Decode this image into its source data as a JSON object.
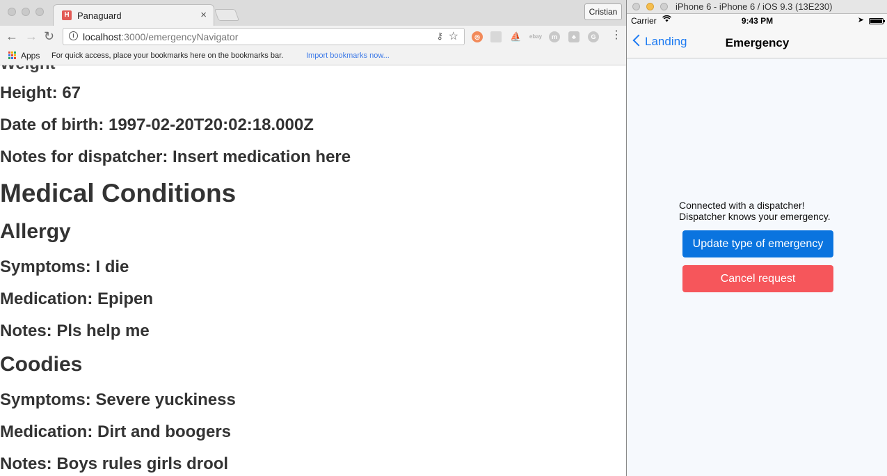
{
  "browser": {
    "tab_title": "Panaguard",
    "tab_favicon_letter": "H",
    "tab_close": "×",
    "profile_name": "Cristian",
    "url_host": "localhost",
    "url_path": ":3000/emergencyNavigator",
    "bookmarks": {
      "apps_label": "Apps",
      "hint": "For quick access, place your bookmarks here on the bookmarks bar.",
      "import_link": "Import bookmarks now..."
    }
  },
  "page": {
    "height": "Height: 67",
    "dob": "Date of birth: 1997-02-20T20:02:18.000Z",
    "notes_dispatcher": "Notes for dispatcher: Insert medication here",
    "conditions_heading": "Medical Conditions",
    "conditions": [
      {
        "name": "Allergy",
        "symptoms": "Symptoms: I die",
        "medication": "Medication: Epipen",
        "notes": "Notes: Pls help me"
      },
      {
        "name": "Coodies",
        "symptoms": "Symptoms: Severe yuckiness",
        "medication": "Medication: Dirt and boogers",
        "notes": "Notes: Boys rules girls drool"
      }
    ]
  },
  "simulator": {
    "window_title": "iPhone 6 - iPhone 6 / iOS 9.3 (13E230)",
    "status": {
      "carrier": "Carrier",
      "time": "9:43 PM"
    },
    "nav": {
      "back_label": "Landing",
      "title": "Emergency"
    },
    "message_line1": "Connected with a dispatcher!",
    "message_line2": "Dispatcher knows your emergency.",
    "update_button": "Update type of emergency",
    "cancel_button": "Cancel request"
  },
  "colors": {
    "ios_blue": "#0a74df",
    "cancel_red": "#f6565b",
    "link_blue": "#1e7bf2"
  }
}
